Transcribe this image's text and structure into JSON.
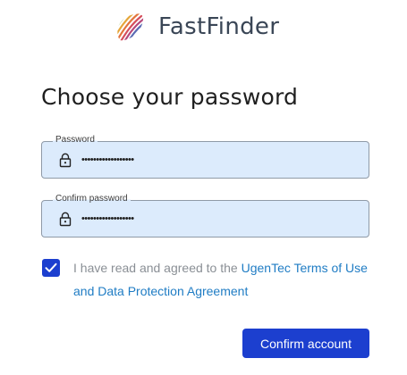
{
  "brand": {
    "name": "FastFinder",
    "logo_icon": "striped-leaf-logo"
  },
  "page_title": "Choose your password",
  "password_field": {
    "label": "Password",
    "value": "••••••••••••••••••",
    "icon": "lock-icon"
  },
  "confirm_password_field": {
    "label": "Confirm password",
    "value": "••••••••••••••••••",
    "icon": "lock-icon"
  },
  "agreement": {
    "checked": true,
    "text_prefix": "I have read and agreed to the ",
    "link_text": "UgenTec Terms of Use and Data Protection Agreement"
  },
  "confirm_button": {
    "label": "Confirm account"
  },
  "colors": {
    "accent": "#1c3fcf",
    "field_background": "#dcebfc",
    "link": "#1f7cc4",
    "brand_text": "#3a4656"
  }
}
